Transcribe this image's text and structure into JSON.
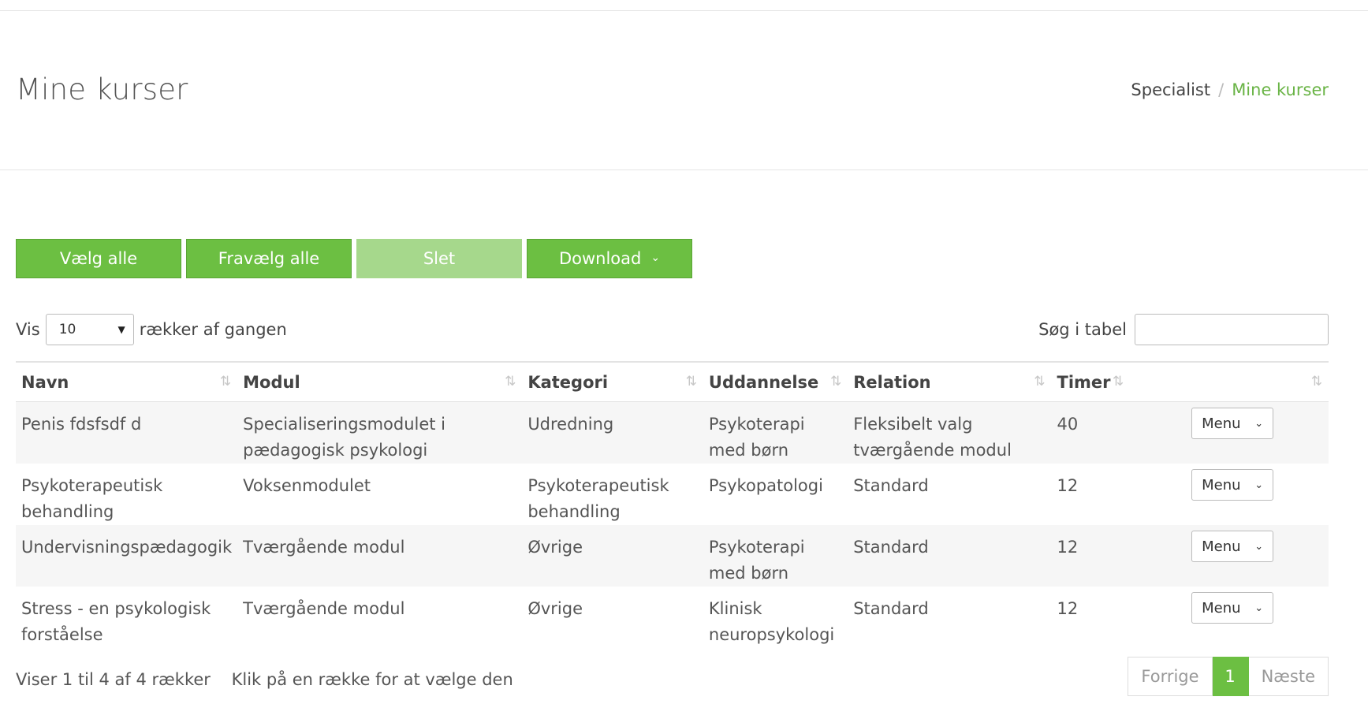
{
  "header": {
    "title": "Mine kurser",
    "breadcrumb": {
      "parent": "Specialist",
      "separator": "/",
      "current": "Mine kurser"
    }
  },
  "toolbar": {
    "select_all": "Vælg alle",
    "deselect_all": "Fravælg alle",
    "delete": "Slet",
    "download": "Download"
  },
  "length": {
    "prefix": "Vis",
    "value": "10",
    "suffix": "rækker af gangen"
  },
  "search": {
    "label": "Søg i tabel",
    "value": ""
  },
  "table": {
    "columns": [
      "Navn",
      "Modul",
      "Kategori",
      "Uddannelse",
      "Relation",
      "Timer",
      ""
    ],
    "rows": [
      {
        "navn": "Penis fdsfsdf d",
        "modul": "Specialiseringsmodulet i pædagogisk psykologi",
        "kategori": "Udredning",
        "uddannelse": "Psykoterapi med børn",
        "relation": "Fleksibelt valg tværgående modul",
        "timer": "40",
        "menu": "Menu"
      },
      {
        "navn": "Psykoterapeutisk behandling",
        "modul": "Voksenmodulet",
        "kategori": "Psykoterapeutisk behandling",
        "uddannelse": "Psykopatologi",
        "relation": "Standard",
        "timer": "12",
        "menu": "Menu"
      },
      {
        "navn": "Undervisningspædagogik",
        "modul": "Tværgående modul",
        "kategori": "Øvrige",
        "uddannelse": "Psykoterapi med børn",
        "relation": "Standard",
        "timer": "12",
        "menu": "Menu"
      },
      {
        "navn": "Stress - en psykologisk forståelse",
        "modul": "Tværgående modul",
        "kategori": "Øvrige",
        "uddannelse": "Klinisk neuropsykologi",
        "relation": "Standard",
        "timer": "12",
        "menu": "Menu"
      }
    ]
  },
  "footer": {
    "info": "Viser 1 til 4 af 4 rækker",
    "hint": "Klik på en række for at vælge den",
    "pager": {
      "prev": "Forrige",
      "page": "1",
      "next": "Næste"
    }
  },
  "icons": {
    "sort": "sort-arrows-icon",
    "chevron": "chevron-down-icon",
    "select_caret": "caret-down-icon"
  },
  "colors": {
    "accent": "#6cbf42",
    "accent_disabled": "#a6d88c",
    "breadcrumb_active": "#6ab446"
  }
}
